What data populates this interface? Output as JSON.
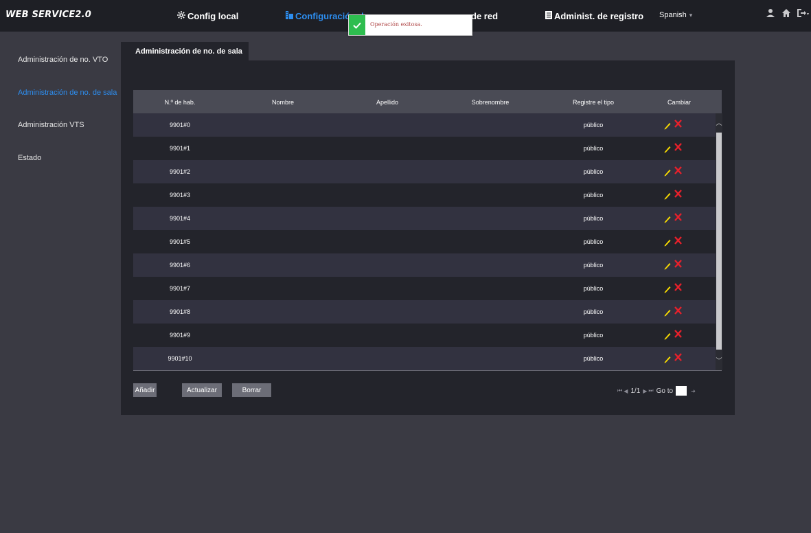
{
  "header": {
    "logo": "WEB SERVICE2.0",
    "nav": [
      {
        "label": "Config local",
        "icon": "gear-icon",
        "active": false
      },
      {
        "label": "Configuración de",
        "icon": "building-icon",
        "active": true
      },
      {
        "label": "de red",
        "icon": "network-icon",
        "active": false
      },
      {
        "label": "Administ. de registro",
        "icon": "document-icon",
        "active": false
      }
    ],
    "language": "Spanish",
    "icons": [
      "user-icon",
      "home-icon",
      "logout-icon"
    ]
  },
  "toast": {
    "message": "Operación exitosa."
  },
  "sidebar": {
    "items": [
      {
        "label": "Administración de no. VTO",
        "active": false
      },
      {
        "label": "Administración de no. de sala",
        "active": true
      },
      {
        "label": "Administración VTS",
        "active": false
      },
      {
        "label": "Estado",
        "active": false
      }
    ]
  },
  "main": {
    "tab": "Administración de no. de sala",
    "table": {
      "columns": [
        "N.º de hab.",
        "Nombre",
        "Apellido",
        "Sobrenombre",
        "Registre el tipo",
        "Cambiar"
      ],
      "rows": [
        {
          "room": "9901#0",
          "name": "",
          "surname": "",
          "nickname": "",
          "type": "público"
        },
        {
          "room": "9901#1",
          "name": "",
          "surname": "",
          "nickname": "",
          "type": "público"
        },
        {
          "room": "9901#2",
          "name": "",
          "surname": "",
          "nickname": "",
          "type": "público"
        },
        {
          "room": "9901#3",
          "name": "",
          "surname": "",
          "nickname": "",
          "type": "público"
        },
        {
          "room": "9901#4",
          "name": "",
          "surname": "",
          "nickname": "",
          "type": "público"
        },
        {
          "room": "9901#5",
          "name": "",
          "surname": "",
          "nickname": "",
          "type": "público"
        },
        {
          "room": "9901#6",
          "name": "",
          "surname": "",
          "nickname": "",
          "type": "público"
        },
        {
          "room": "9901#7",
          "name": "",
          "surname": "",
          "nickname": "",
          "type": "público"
        },
        {
          "room": "9901#8",
          "name": "",
          "surname": "",
          "nickname": "",
          "type": "público"
        },
        {
          "room": "9901#9",
          "name": "",
          "surname": "",
          "nickname": "",
          "type": "público"
        },
        {
          "room": "9901#10",
          "name": "",
          "surname": "",
          "nickname": "",
          "type": "público"
        }
      ]
    },
    "buttons": {
      "add": "Añadir",
      "refresh": "Actualizar",
      "delete": "Borrar"
    },
    "pagination": {
      "page_info": "1/1",
      "goto_label": "Go to",
      "goto_value": ""
    }
  },
  "colors": {
    "accent": "#2d8ef0",
    "delete": "#e8202b",
    "edit": "#f5d800",
    "toast_success": "#2ebd4f"
  }
}
